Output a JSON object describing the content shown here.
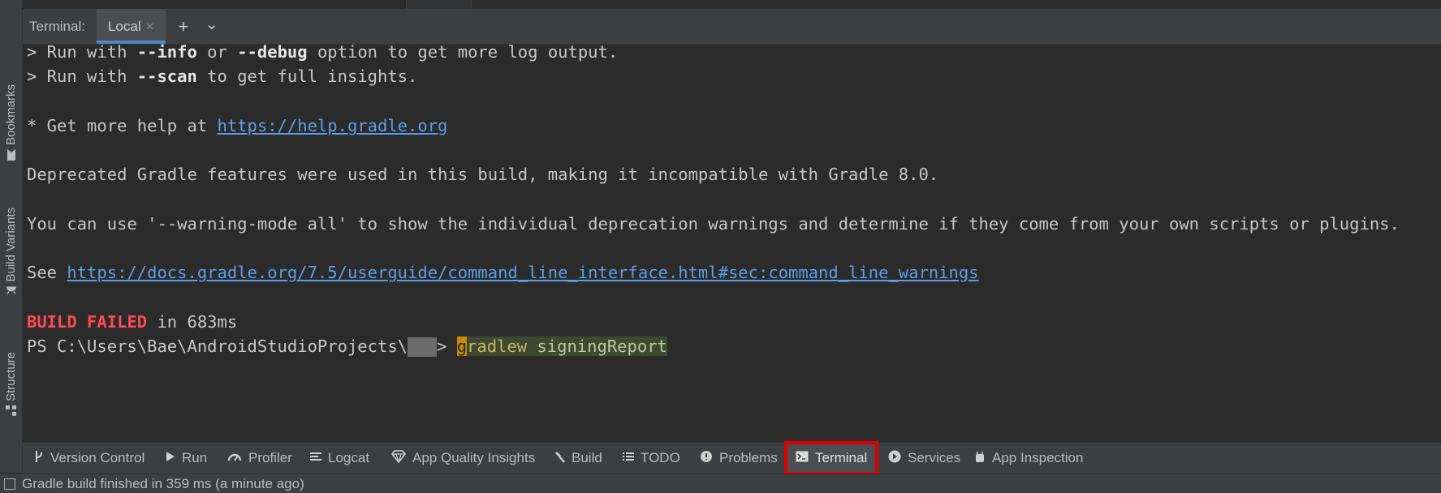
{
  "left_strip": {
    "tabs": [
      {
        "label": "Bookmarks",
        "icon": "bookmark-icon"
      },
      {
        "label": "Build Variants",
        "icon": "android-icon"
      },
      {
        "label": "Structure",
        "icon": "structure-icon"
      }
    ]
  },
  "terminal": {
    "title": "Terminal:",
    "tab_label": "Local",
    "close_glyph": "×",
    "add_glyph": "+",
    "dropdown_glyph": "⌄",
    "lines": {
      "l1_prompt": "> Run with ",
      "l1_info": "--info",
      "l1_or": " or ",
      "l1_debug": "--debug",
      "l1_rest": " option to get more log output.",
      "l2_prompt": "> Run with ",
      "l2_scan": "--scan",
      "l2_rest": " to get full insights.",
      "l3_prefix": "* Get more help at ",
      "l3_link": "https://help.gradle.org",
      "l4": "Deprecated Gradle features were used in this build, making it incompatible with Gradle 8.0.",
      "l5": "You can use '--warning-mode all' to show the individual deprecation warnings and determine if they come from your own scripts or plugins.",
      "l6_prefix": "See ",
      "l6_link": "https://docs.gradle.org/7.5/userguide/command_line_interface.html#sec:command_line_warnings",
      "l7_failed": "BUILD FAILED",
      "l7_rest": " in 683ms",
      "prompt_path": "PS C:\\Users\\Bae\\AndroidStudioProjects\\",
      "prompt_gt": "> ",
      "cmd_first": "g",
      "cmd_word": "radlew",
      "cmd_arg": " signingReport"
    }
  },
  "tool_bar": {
    "items": [
      {
        "label": "Version Control",
        "icon": "branch-icon"
      },
      {
        "label": "Run",
        "icon": "play-icon"
      },
      {
        "label": "Profiler",
        "icon": "gauge-icon"
      },
      {
        "label": "Logcat",
        "icon": "logcat-icon"
      },
      {
        "label": "App Quality Insights",
        "icon": "diamond-icon"
      },
      {
        "label": "Build",
        "icon": "hammer-icon"
      },
      {
        "label": "TODO",
        "icon": "list-icon"
      },
      {
        "label": "Problems",
        "icon": "info-circle-icon"
      },
      {
        "label": "Terminal",
        "icon": "terminal-icon",
        "active": true
      },
      {
        "label": "Services",
        "icon": "services-icon"
      },
      {
        "label": "App Inspection",
        "icon": "inspection-icon"
      }
    ]
  },
  "status_bar": {
    "message": "Gradle build finished in 359 ms (a minute ago)"
  },
  "colors": {
    "background": "#2b2b2b",
    "link": "#5c9ee8",
    "error": "#ff4b55",
    "highlight_box": "#e00000",
    "tab_underline": "#4a88c7"
  }
}
